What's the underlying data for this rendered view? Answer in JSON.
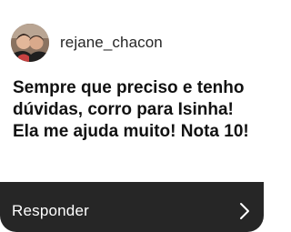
{
  "reply_card": {
    "username": "rejane_chacon",
    "message": "Sempre que preciso e tenho dúvidas, corro para Isinha! Ela me ajuda muito! Nota 10!",
    "reply_label": "Responder",
    "avatar_icon": "user-avatar-photo",
    "chevron_icon": "chevron-right-icon"
  }
}
